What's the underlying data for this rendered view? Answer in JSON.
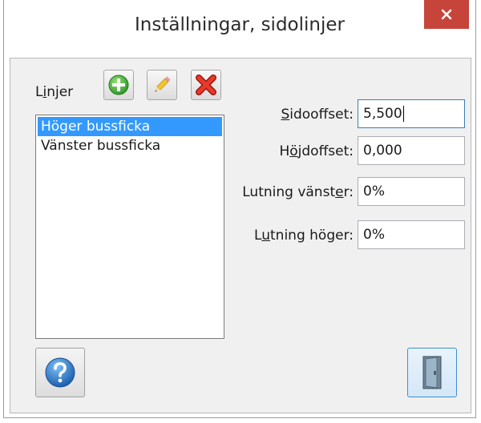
{
  "window": {
    "title": "Inställningar, sidolinjer"
  },
  "lines": {
    "label_pre": "L",
    "label_u": "i",
    "label_post": "njer",
    "items": [
      "Höger bussficka",
      "Vänster bussficka"
    ],
    "selected_index": 0
  },
  "fields": {
    "side_offset": {
      "label_pre": "",
      "label_u": "S",
      "label_post": "idooffset:",
      "value": "5,500"
    },
    "height_offset": {
      "label_pre": "H",
      "label_u": "ö",
      "label_post": "jdoffset:",
      "value": "0,000"
    },
    "slope_left": {
      "label_pre": "Lutning vänst",
      "label_u": "e",
      "label_post": "r:",
      "value": "0%"
    },
    "slope_right": {
      "label_pre": "L",
      "label_u": "u",
      "label_post": "tning höger:",
      "value": "0%"
    }
  },
  "icons": {
    "add": "plus-circle-icon",
    "edit": "pencil-icon",
    "delete": "red-x-icon",
    "help": "question-mark-icon",
    "exit": "door-icon",
    "close": "close-icon"
  },
  "colors": {
    "close_button": "#c7443a",
    "selection": "#3399ff",
    "focus_border": "#3c7fb1"
  }
}
